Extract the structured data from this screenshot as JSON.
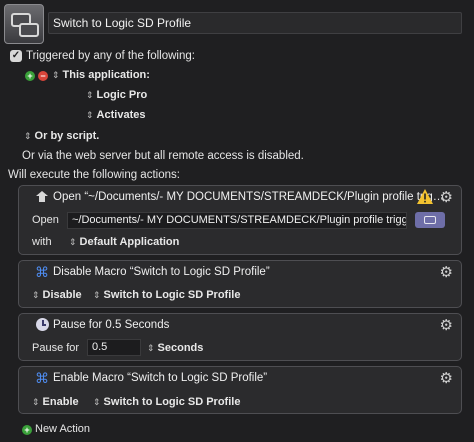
{
  "macro": {
    "name": "Switch to Logic SD Profile"
  },
  "triggers": {
    "checkbox_label": "Triggered by any of the following:",
    "this_application_label": "This application:",
    "application_name": "Logic Pro",
    "event": "Activates",
    "or_by_script": "Or by script.",
    "web_server_text": "Or via the web server but all remote access is disabled."
  },
  "actions_header": "Will execute the following actions:",
  "actions": [
    {
      "title": "Open “~/Documents/- MY DOCUMENTS/STREAMDECK/Plugin profile trig…",
      "open_label": "Open",
      "path": "~/Documents/- MY DOCUMENTS/STREAMDECK/Plugin profile trigge",
      "with_label": "with",
      "application": "Default Application"
    },
    {
      "title": "Disable Macro “Switch to Logic SD Profile”",
      "mode": "Disable",
      "target": "Switch to Logic SD Profile"
    },
    {
      "title": "Pause for 0.5 Seconds",
      "pause_label": "Pause for",
      "value": "0.5",
      "unit": "Seconds"
    },
    {
      "title": "Enable Macro “Switch to Logic SD Profile”",
      "mode": "Enable",
      "target": "Switch to Logic SD Profile"
    }
  ],
  "new_action_label": "New Action",
  "colors": {
    "add": "#3aa13a",
    "remove": "#d8453a",
    "warning": "#f2c230",
    "command": "#4e8cf0",
    "pick": "#6e6ea8"
  }
}
